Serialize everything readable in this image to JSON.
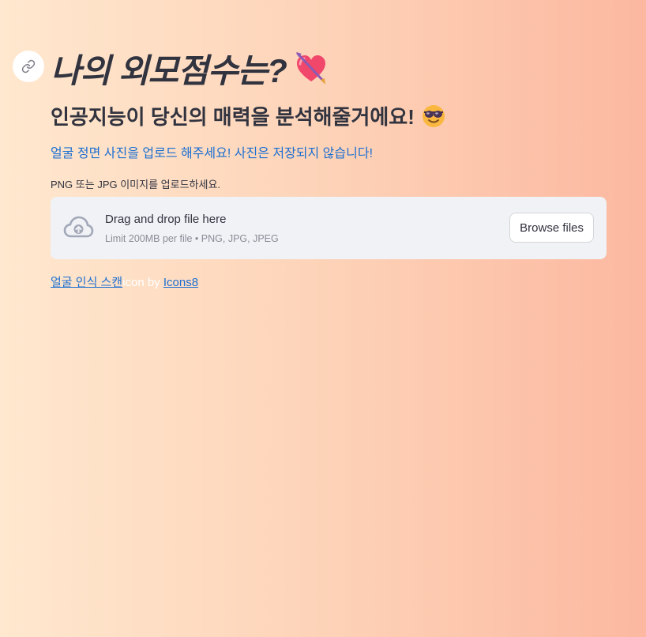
{
  "header": {
    "title": "나의 외모점수는?",
    "title_emoji": "heart-with-arrow",
    "subtitle": "인공지능이 당신의 매력을 분석해줄거에요!",
    "subtitle_emoji": "smiling-face-with-sunglasses"
  },
  "notice": "얼굴 정면 사진을 업로드 해주세요! 사진은 저장되지 않습니다!",
  "uploader": {
    "label": "PNG 또는 JPG 이미지를 업로드하세요.",
    "drop_text": "Drag and drop file here",
    "limit_text": "Limit 200MB per file • PNG, JPG, JPEG",
    "browse_label": "Browse files",
    "icon": "cloud-upload-icon"
  },
  "credit": {
    "link1": "얼굴 인식 스캔",
    "middle": "icon by",
    "link2": "Icons8"
  },
  "colors": {
    "gradient_start": "#ffe8cf",
    "gradient_end": "#fcb8a0",
    "link_blue": "#1c6fd1",
    "dropzone_bg": "#f0f2f6",
    "text": "#31333f"
  }
}
